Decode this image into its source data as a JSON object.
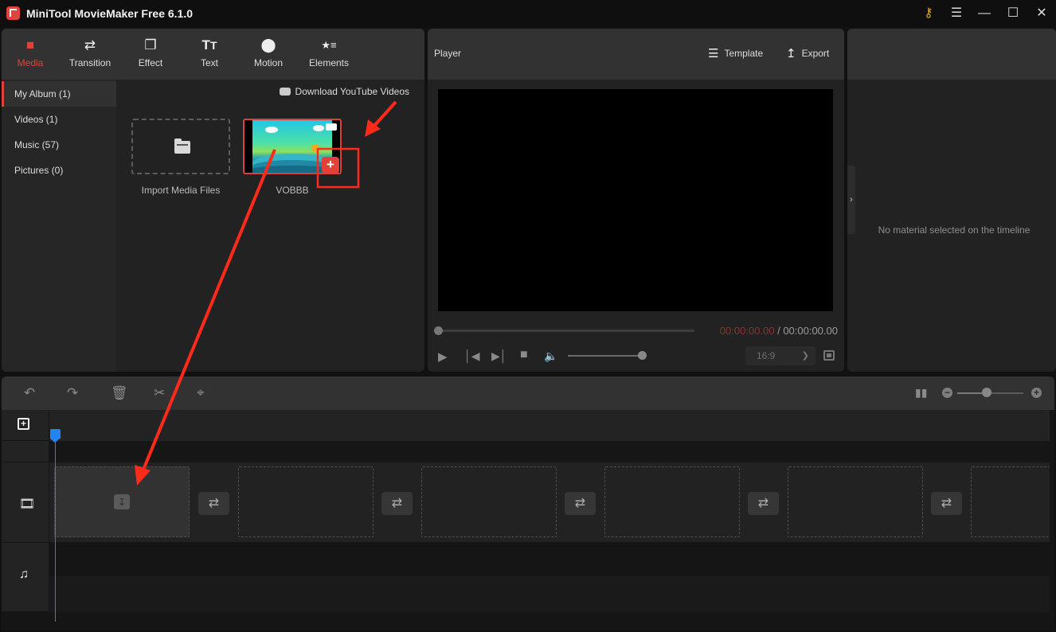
{
  "window": {
    "title": "MiniTool MovieMaker Free 6.1.0",
    "controls": [
      "key-icon",
      "menu-icon",
      "minimize-icon",
      "maximize-icon",
      "close-icon"
    ],
    "accent_color": "#e2413a"
  },
  "toolbar": {
    "tabs": [
      {
        "label": "Media",
        "icon": "folder-icon",
        "active": true
      },
      {
        "label": "Transition",
        "icon": "swap-arrows-icon",
        "active": false
      },
      {
        "label": "Effect",
        "icon": "layers-square-icon",
        "active": false
      },
      {
        "label": "Text",
        "icon": "text-tt-icon",
        "active": false
      },
      {
        "label": "Motion",
        "icon": "motion-circle-icon",
        "active": false
      },
      {
        "label": "Elements",
        "icon": "star-list-icon",
        "active": false
      }
    ]
  },
  "media": {
    "sidebar": [
      {
        "label": "My Album (1)",
        "active": true
      },
      {
        "label": "Videos (1)",
        "active": false
      },
      {
        "label": "Music (57)",
        "active": false
      },
      {
        "label": "Pictures (0)",
        "active": false
      }
    ],
    "download_link": "Download YouTube Videos",
    "import_label": "Import Media Files",
    "items": [
      {
        "name": "VOBBB",
        "type": "video"
      }
    ],
    "add_button": "+"
  },
  "player": {
    "title": "Player",
    "template_label": "Template",
    "export_label": "Export",
    "current_time": "00:00:00.00",
    "separator": " / ",
    "total_time": "00:00:00.00",
    "progress": 0,
    "volume": 1.0,
    "aspect_ratio": "16:9"
  },
  "properties": {
    "empty_message": "No material selected on the timeline",
    "collapse_icon": "›"
  },
  "timeline_toolbar": {
    "tools": [
      "undo-icon",
      "redo-icon",
      "delete-icon",
      "split-icon",
      "crop-icon"
    ],
    "zoom_level": 0.45
  },
  "timeline": {
    "tracks": [
      "add-track-icon",
      "video-track-icon",
      "audio-track-icon"
    ],
    "video_slots": 6,
    "transition_buttons": 5
  },
  "annotations": {
    "color": "#ff2a1a",
    "highlight_box": true,
    "arrows": [
      "pointer-to-add-button",
      "drag-to-timeline"
    ]
  }
}
